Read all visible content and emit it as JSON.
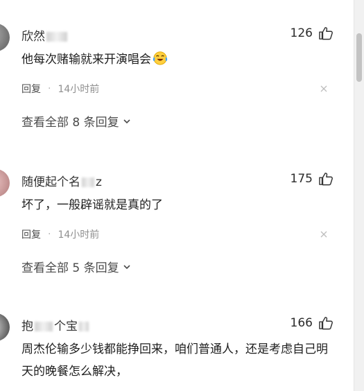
{
  "comments": [
    {
      "username": "欣然",
      "username_tail": "",
      "likes": "126",
      "text": "他每次赌输就来开演唱会",
      "emoji": "laughing-crying-emoji",
      "reply_label": "回复",
      "time": "14小时前",
      "view_replies": "查看全部 8 条回复"
    },
    {
      "username": "随便起个名",
      "username_tail": "z",
      "likes": "175",
      "text": "坏了，一般辟谣就是真的了",
      "reply_label": "回复",
      "time": "14小时前",
      "view_replies": "查看全部 5 条回复"
    },
    {
      "username": "抱",
      "username_tail": "个宝",
      "likes": "166",
      "text": "周杰伦输多少钱都能挣回来，咱们普通人，还是考虑自己明天的晚餐怎么解决，"
    }
  ],
  "separator": "·"
}
